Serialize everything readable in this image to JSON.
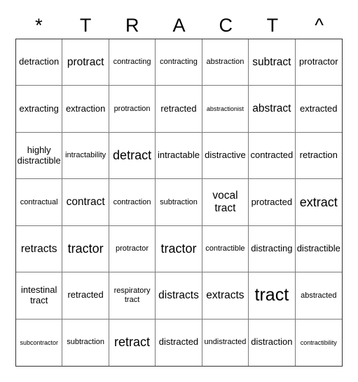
{
  "title_letters": [
    "*",
    "T",
    "R",
    "A",
    "C",
    "T",
    "^"
  ],
  "cells": [
    [
      {
        "text": "detraction",
        "size": "m"
      },
      {
        "text": "protract",
        "size": "l"
      },
      {
        "text": "contracting",
        "size": "s"
      },
      {
        "text": "contracting",
        "size": "s"
      },
      {
        "text": "abstraction",
        "size": "s"
      },
      {
        "text": "subtract",
        "size": "l"
      },
      {
        "text": "protractor",
        "size": "m"
      }
    ],
    [
      {
        "text": "extracting",
        "size": "m"
      },
      {
        "text": "extraction",
        "size": "m"
      },
      {
        "text": "protraction",
        "size": "s"
      },
      {
        "text": "retracted",
        "size": "m"
      },
      {
        "text": "abstractionist",
        "size": "xs"
      },
      {
        "text": "abstract",
        "size": "l"
      },
      {
        "text": "extracted",
        "size": "m"
      }
    ],
    [
      {
        "text": "highly distractible",
        "size": "m"
      },
      {
        "text": "intractability",
        "size": "s"
      },
      {
        "text": "detract",
        "size": "xl"
      },
      {
        "text": "intractable",
        "size": "m"
      },
      {
        "text": "distractive",
        "size": "m"
      },
      {
        "text": "contracted",
        "size": "m"
      },
      {
        "text": "retraction",
        "size": "m"
      }
    ],
    [
      {
        "text": "contractual",
        "size": "s"
      },
      {
        "text": "contract",
        "size": "l"
      },
      {
        "text": "contraction",
        "size": "s"
      },
      {
        "text": "subtraction",
        "size": "s"
      },
      {
        "text": "vocal tract",
        "size": "l"
      },
      {
        "text": "protracted",
        "size": "m"
      },
      {
        "text": "extract",
        "size": "xl"
      }
    ],
    [
      {
        "text": "retracts",
        "size": "l"
      },
      {
        "text": "tractor",
        "size": "xl"
      },
      {
        "text": "protractor",
        "size": "s"
      },
      {
        "text": "tractor",
        "size": "xl"
      },
      {
        "text": "contractible",
        "size": "s"
      },
      {
        "text": "distracting",
        "size": "m"
      },
      {
        "text": "distractible",
        "size": "m"
      }
    ],
    [
      {
        "text": "intestinal tract",
        "size": "m"
      },
      {
        "text": "retracted",
        "size": "m"
      },
      {
        "text": "respiratory tract",
        "size": "s"
      },
      {
        "text": "distracts",
        "size": "l"
      },
      {
        "text": "extracts",
        "size": "l"
      },
      {
        "text": "tract",
        "size": "xxl"
      },
      {
        "text": "abstracted",
        "size": "s"
      }
    ],
    [
      {
        "text": "subcontractor",
        "size": "xs"
      },
      {
        "text": "subtraction",
        "size": "s"
      },
      {
        "text": "retract",
        "size": "xl"
      },
      {
        "text": "distracted",
        "size": "m"
      },
      {
        "text": "undistracted",
        "size": "s"
      },
      {
        "text": "distraction",
        "size": "m"
      },
      {
        "text": "contractibility",
        "size": "xs"
      }
    ]
  ]
}
